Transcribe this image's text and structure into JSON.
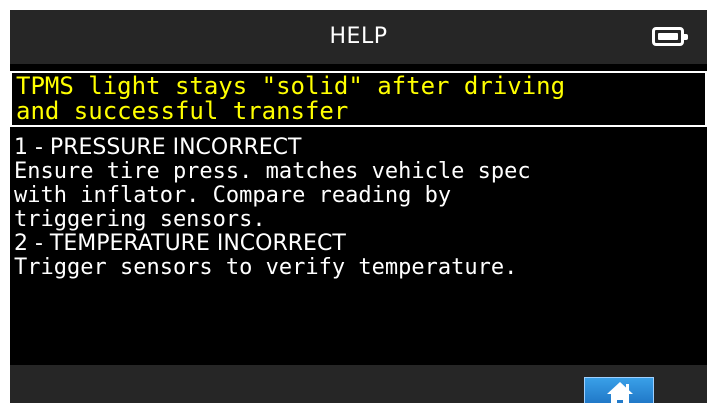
{
  "header": {
    "title": "HELP",
    "battery_icon": "battery-full-icon"
  },
  "topic": {
    "lines": [
      "TPMS light stays \"solid\" after driving",
      "and successful transfer"
    ],
    "color": "#ffff00"
  },
  "content": {
    "heading1": "1 - PRESSURE INCORRECT",
    "text1": [
      "Ensure tire press. matches vehicle spec",
      "with inflator. Compare reading by",
      "triggering sensors."
    ],
    "heading2": "2 - TEMPERATURE INCORRECT",
    "text2": [
      "Trigger sensors to verify temperature."
    ]
  },
  "footer": {
    "home_icon": "home-icon",
    "button_color": "#2a86d8"
  }
}
